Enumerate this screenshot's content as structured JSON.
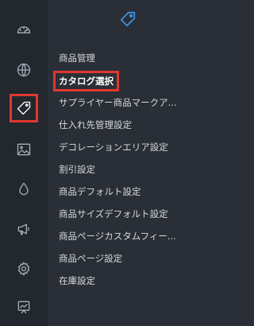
{
  "rail": {
    "icons": [
      {
        "name": "dashboard-gauge-icon"
      },
      {
        "name": "globe-icon"
      },
      {
        "name": "tag-icon",
        "active": true
      },
      {
        "name": "image-icon"
      },
      {
        "name": "droplet-icon"
      },
      {
        "name": "megaphone-icon"
      },
      {
        "name": "gear-icon"
      },
      {
        "name": "chart-board-icon"
      }
    ]
  },
  "panel": {
    "header_icon": "tag-icon",
    "items": [
      {
        "label": "商品管理"
      },
      {
        "label": "カタログ選択",
        "active": true
      },
      {
        "label": "サプライヤー商品マークア..."
      },
      {
        "label": "仕入れ先管理設定"
      },
      {
        "label": "デコレーションエリア設定"
      },
      {
        "label": "割引設定"
      },
      {
        "label": "商品デフォルト設定"
      },
      {
        "label": "商品サイズデフォルト設定"
      },
      {
        "label": "商品ページカスタムフィー..."
      },
      {
        "label": "商品ページ設定"
      },
      {
        "label": "在庫設定"
      }
    ]
  },
  "colors": {
    "rail_bg": "#23272e",
    "panel_bg": "#2a2f37",
    "accent_blue": "#3f97e8",
    "highlight_red": "#e0392f",
    "text": "#d4d8de"
  }
}
